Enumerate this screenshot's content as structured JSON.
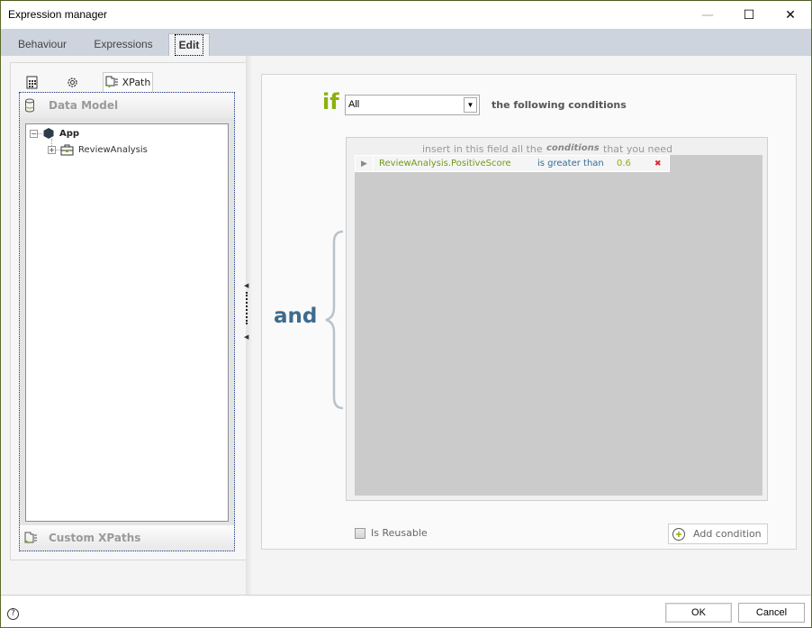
{
  "window": {
    "title": "Expression manager",
    "controls": {
      "minimize": "—",
      "maximize": "☐",
      "close": "✕"
    }
  },
  "tabs": [
    {
      "label": "Behaviour",
      "active": false
    },
    {
      "label": "Expressions",
      "active": false
    },
    {
      "label": "Edit",
      "active": true
    }
  ],
  "left_panel": {
    "tabs": [
      {
        "icon": "table-icon",
        "label": ""
      },
      {
        "icon": "gear-icon",
        "label": ""
      },
      {
        "icon": "xpath-icon",
        "label": "XPath",
        "active": true
      }
    ],
    "data_model_header": "Data Model",
    "tree": {
      "root": {
        "label": "App",
        "expanded": true
      },
      "children": [
        {
          "label": "ReviewAnalysis",
          "expanded": false
        }
      ]
    },
    "custom_xpaths_header": "Custom XPaths"
  },
  "editor": {
    "if_label": "if",
    "match_select": {
      "value": "All"
    },
    "following_label": "the following conditions",
    "and_label": "and",
    "hint": {
      "prefix": "insert in this field all the",
      "emphasis": "conditions",
      "suffix": "that you need"
    },
    "conditions": [
      {
        "field": "ReviewAnalysis.PositiveScore",
        "operator": "is greater than",
        "value": "0.6",
        "delete_icon": "✖"
      }
    ],
    "is_reusable": {
      "label": "Is Reusable",
      "checked": false
    },
    "add_condition_label": "Add condition"
  },
  "footer": {
    "help_icon": "?",
    "ok_label": "OK",
    "cancel_label": "Cancel"
  },
  "colors": {
    "if_green": "#8cb10f",
    "and_blue": "#3e6b8e",
    "field_green": "#6f9a1c",
    "operator_blue": "#2f6e9c",
    "delete_red": "#e0242a"
  }
}
